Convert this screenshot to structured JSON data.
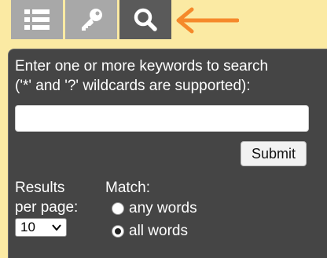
{
  "tabs": [
    {
      "icon": "list-icon",
      "state": "inactive"
    },
    {
      "icon": "key-icon",
      "state": "inactive"
    },
    {
      "icon": "search-icon",
      "state": "active"
    }
  ],
  "search": {
    "help_line1": "Enter one or more keywords to search",
    "help_line2": "('*' and '?' wildcards are supported):",
    "input_value": "",
    "submit_label": "Submit"
  },
  "results_per_page": {
    "label_line1": "Results",
    "label_line2": "per page:",
    "selected": "10"
  },
  "match": {
    "label": "Match:",
    "options": [
      "any words",
      "all words"
    ],
    "selected": "all words"
  },
  "colors": {
    "background": "#fbeaa3",
    "panel": "#454545",
    "tab_active": "#5a5a5a",
    "tab_inactive": "#a8a8a8",
    "arrow": "#f5892b"
  }
}
